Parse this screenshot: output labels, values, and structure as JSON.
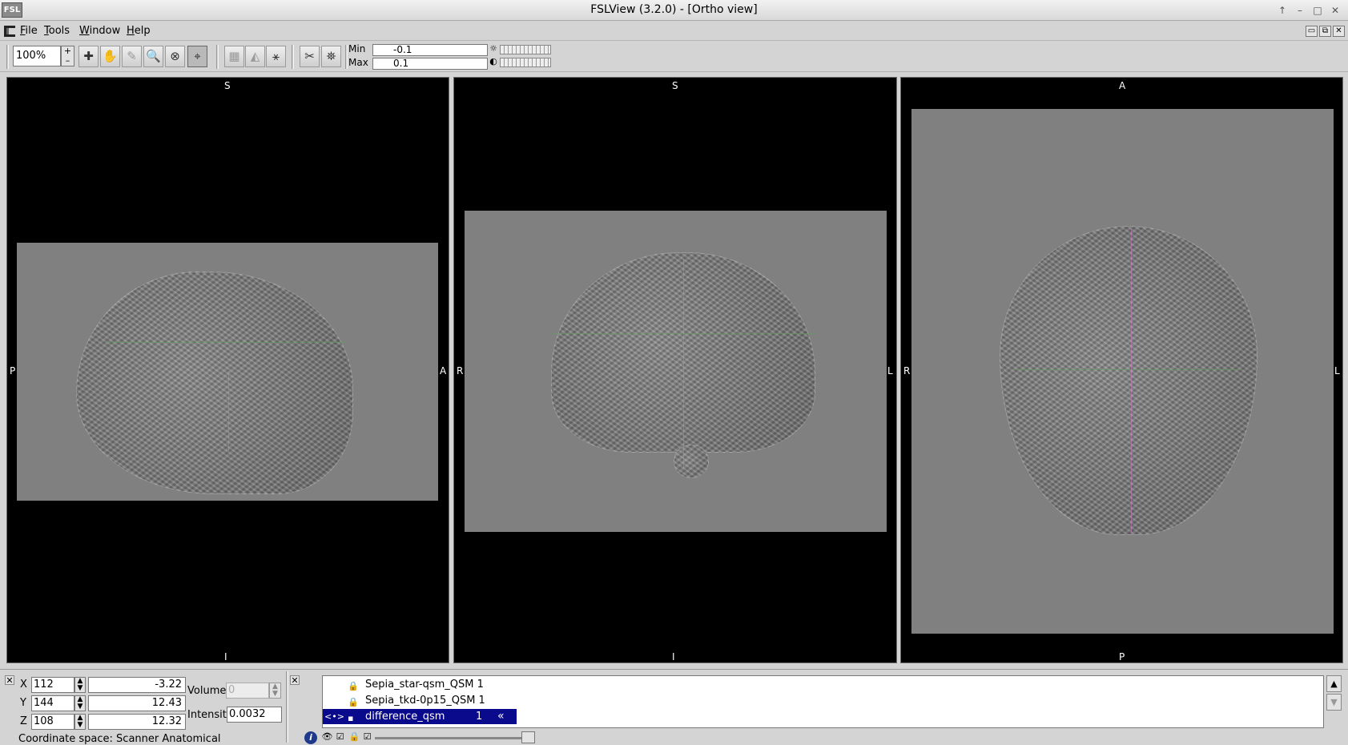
{
  "window": {
    "title": "FSLView (3.2.0) - [Ortho view]",
    "app_icon_label": "FSL",
    "controls": [
      "↑",
      "–",
      "□",
      "✕"
    ]
  },
  "menu": {
    "items": [
      "File",
      "Tools",
      "Window",
      "Help"
    ],
    "mdi_controls": [
      "▭",
      "⧉",
      "✕"
    ]
  },
  "toolbar": {
    "zoom_value": "100%",
    "min_label": "Min",
    "min_value": "-0.1",
    "max_label": "Max",
    "max_value": "0.1"
  },
  "views": {
    "sagittal": {
      "top": "S",
      "bottom": "I",
      "left": "P",
      "right": "A"
    },
    "coronal": {
      "top": "S",
      "bottom": "I",
      "left": "R",
      "right": "L"
    },
    "axial": {
      "top": "A",
      "bottom": "P",
      "left": "R",
      "right": "L"
    }
  },
  "coords": {
    "x_label": "X",
    "x_voxel": "112",
    "x_mm": "-3.22",
    "y_label": "Y",
    "y_voxel": "144",
    "y_mm": "12.43",
    "z_label": "Z",
    "z_voxel": "108",
    "z_mm": "12.32",
    "volume_label": "Volume",
    "volume_value": "0",
    "intensity_label": "Intensity",
    "intensity_value": "0.0032",
    "coordinate_space": "Coordinate space: Scanner Anatomical"
  },
  "layers": [
    {
      "name": "Sepia_star-qsm_QSM 1",
      "number": "",
      "selected": false
    },
    {
      "name": "Sepia_tkd-0p15_QSM 1",
      "number": "",
      "selected": false
    },
    {
      "name": "difference_qsm",
      "number": "1",
      "selected": true
    }
  ],
  "layer_tools": {
    "info": "i",
    "icons": [
      "eye-icon",
      "check-icon",
      "lock-icon",
      "check-icon"
    ]
  }
}
